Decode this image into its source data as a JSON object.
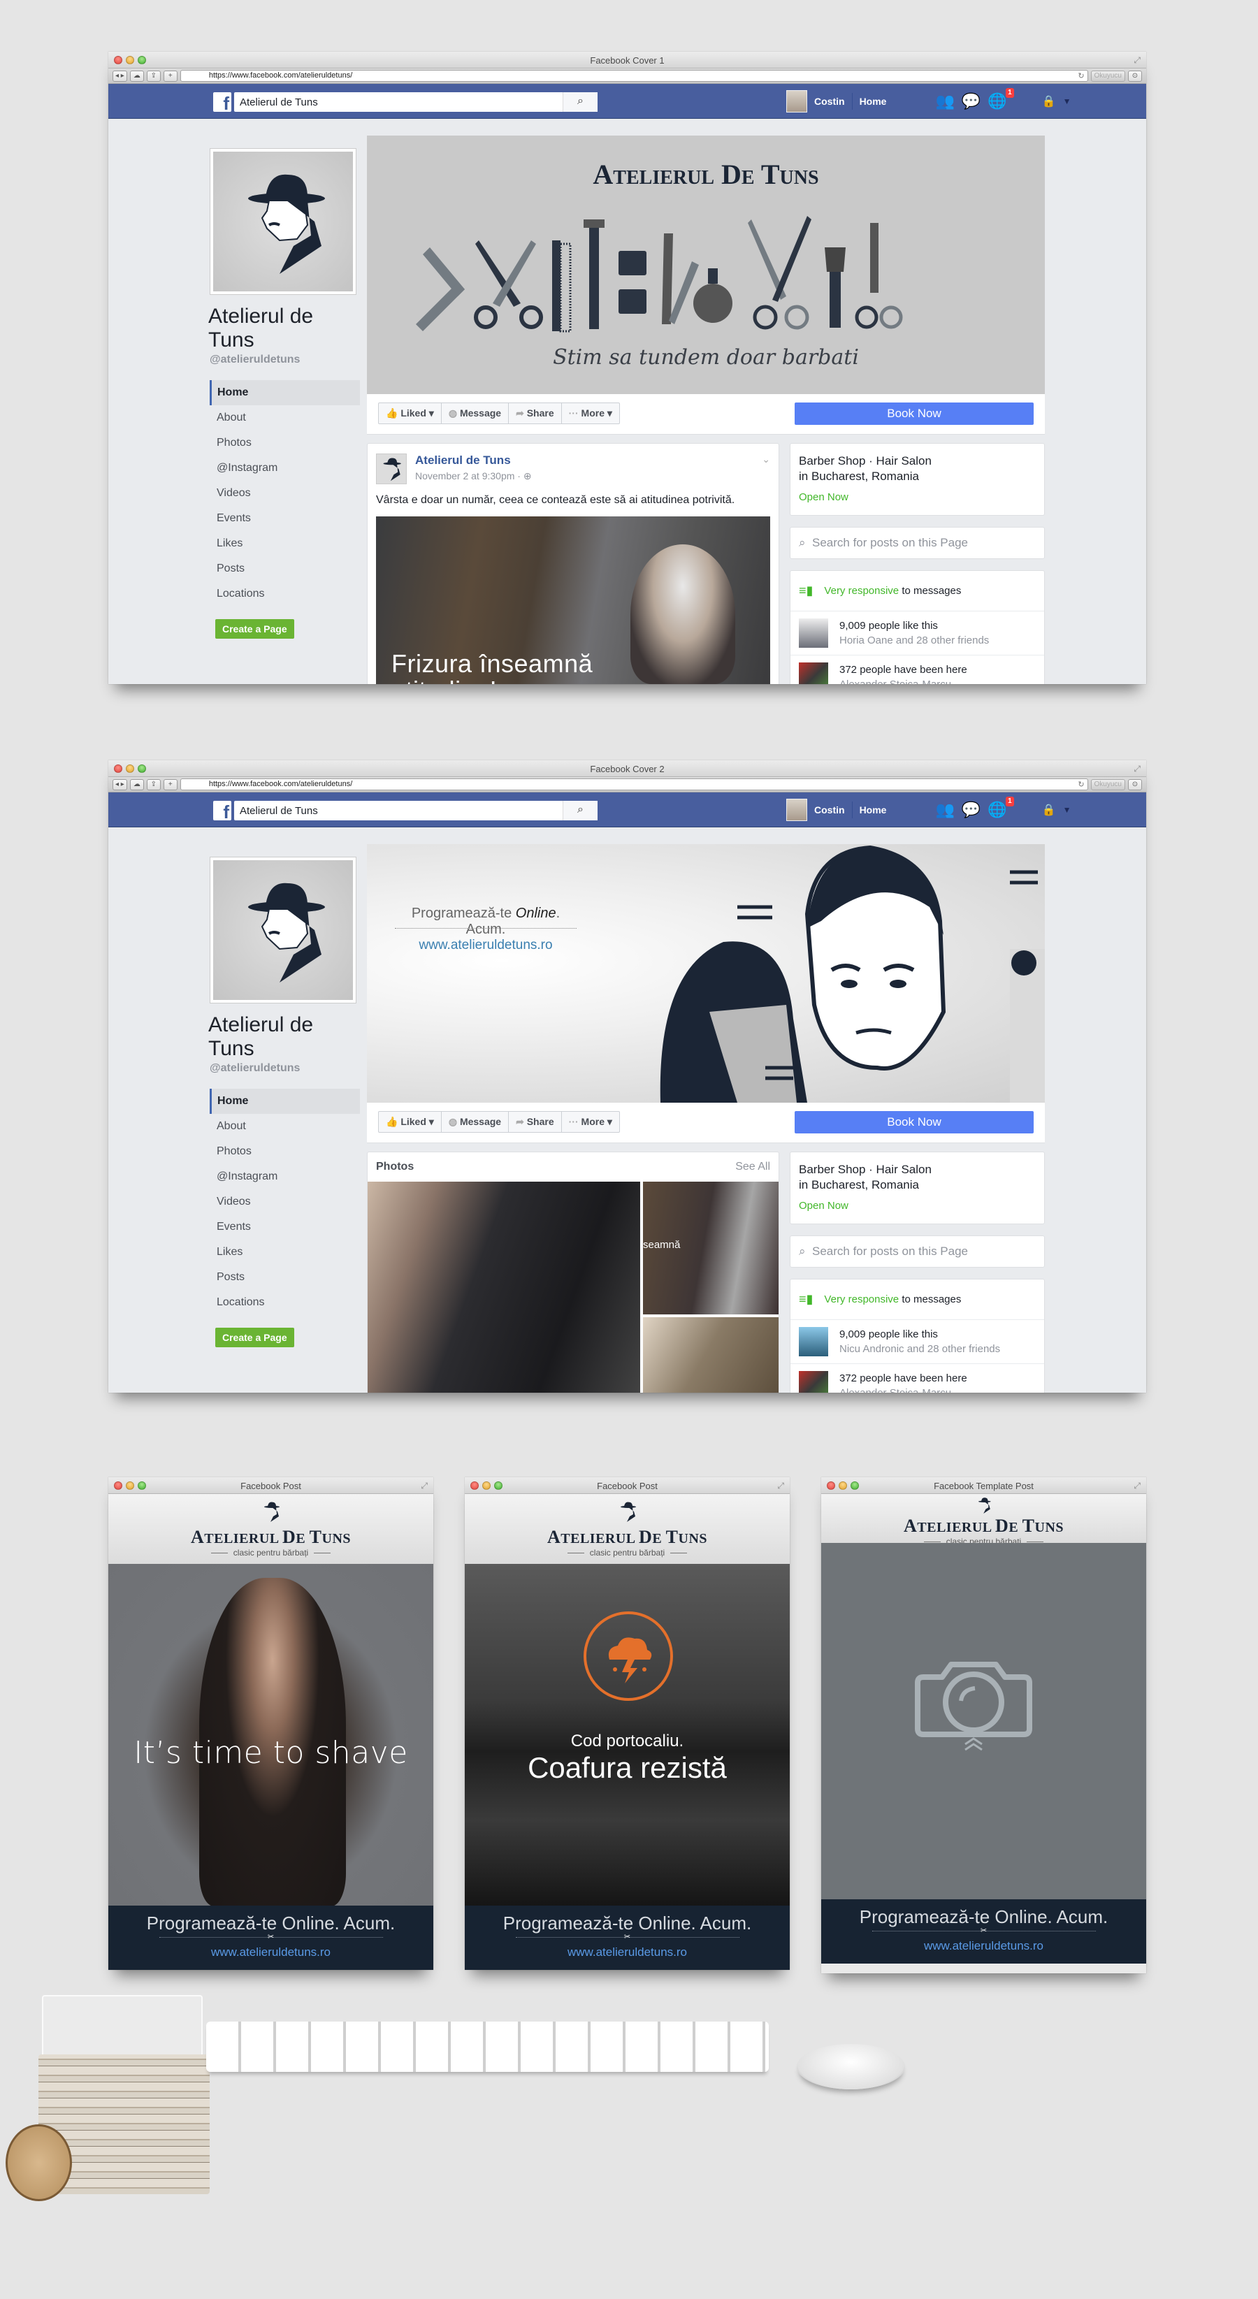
{
  "browser": {
    "url": "https://www.facebook.com/atelieruldetuns/",
    "reader_label": "Okuyucu",
    "add_tab": "+"
  },
  "fb": {
    "search_value": "Atelierul de Tuns",
    "user_name": "Costin",
    "home_label": "Home",
    "notif_count": "1",
    "page_name": "Atelierul de Tuns",
    "page_handle": "@atelieruldetuns",
    "nav": [
      "Home",
      "About",
      "Photos",
      "@Instagram",
      "Videos",
      "Events",
      "Likes",
      "Posts",
      "Locations"
    ],
    "create_page": "Create a Page",
    "actions": {
      "liked": "Liked",
      "message": "Message",
      "share": "Share",
      "more": "More"
    },
    "book_now": "Book Now",
    "info": {
      "category": "Barber Shop · Hair Salon",
      "location": "in Bucharest, Romania",
      "open_now": "Open Now"
    },
    "search_posts_placeholder": "Search for posts on this Page",
    "responsive_green": "Very responsive",
    "responsive_rest": " to messages",
    "likes": "9,009 people like this",
    "been_here": "372 people have been here",
    "been_here_friend": "Alexander Stoica-Marcu"
  },
  "window1": {
    "title": "Facebook Cover 1",
    "cover_title": "Atelierul De Tuns",
    "cover_tagline": "Stim sa tundem doar barbati",
    "likes_friends": "Horia Oane and 28 other friends",
    "post": {
      "author": "Atelierul de Tuns",
      "time": "November 2 at 9:30pm · ",
      "text": "Vârsta e doar un număr, ceea ce contează este să ai atitudinea potrivită.",
      "image_caption_1": "Frizura înseamnă",
      "image_caption_2": "atitudine!"
    }
  },
  "window2": {
    "title": "Facebook Cover 2",
    "cover_line1_a": "Programează-te ",
    "cover_line1_b": "Online",
    "cover_line1_c": ". Acum.",
    "cover_site": "www.atelieruldetuns.ro",
    "likes_friends": "Nicu Andronic and 28 other friends",
    "photos_title": "Photos",
    "photos_see_all": "See All",
    "photo_overlay": "seamnă"
  },
  "post_windows": [
    {
      "title": "Facebook Post",
      "headline": "It’s time to shave"
    },
    {
      "title": "Facebook Post",
      "subline": "Cod portocaliu.",
      "headline": "Coafura rezistă"
    },
    {
      "title": "Facebook Template Post"
    }
  ],
  "brand": {
    "name_a": "A",
    "name_b": "TELIERUL ",
    "name_c": "D",
    "name_d": "E ",
    "name_e": "T",
    "name_f": "UNS",
    "tagline": "clasic pentru bărbați",
    "cta": "Programează-te Online. Acum.",
    "site": "www.atelieruldetuns.ro"
  },
  "colors": {
    "fb_blue": "#485e9e",
    "book_now": "#577ff5",
    "green": "#42b72a",
    "footer_navy": "#172332",
    "orange": "#e4702b"
  }
}
